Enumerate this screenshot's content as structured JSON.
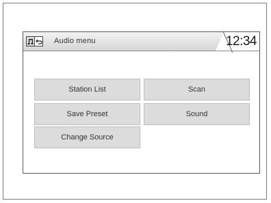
{
  "header": {
    "title": "Audio menu",
    "clock": "12:34",
    "source_icon": "music-note-icon",
    "back_icon": "back-arrow-icon"
  },
  "menu": {
    "station_list": "Station List",
    "scan": "Scan",
    "save_preset": "Save Preset",
    "sound": "Sound",
    "change_source": "Change Source"
  }
}
